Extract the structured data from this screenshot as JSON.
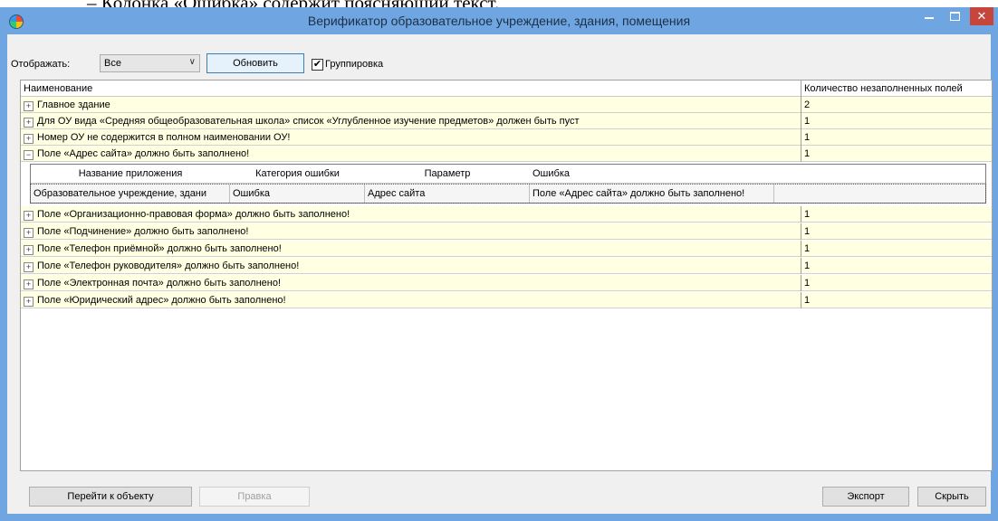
{
  "document_caption": "–    Колонка «Ошибка» содержит поясняющий текст.",
  "window": {
    "title": "Верификатор образовательное учреждение, здания, помещения",
    "close_glyph": "✕"
  },
  "toolbar": {
    "show_label": "Отображать:",
    "show_value": "Все",
    "combo_arrow": "∨",
    "refresh_label": "Обновить",
    "grouping_checked": true,
    "grouping_check_glyph": "✔",
    "grouping_label": "Группировка"
  },
  "grid": {
    "columns": [
      "Наименование",
      "Количество незаполненных полей"
    ],
    "collapsed_glyph": "+",
    "expanded_glyph": "−",
    "rows_before": [
      {
        "name": "Главное здание",
        "count": "2"
      },
      {
        "name": "Для ОУ вида «Средняя общеобразовательная школа» список «Углубленное изучение предметов» должен быть пуст",
        "count": "1"
      },
      {
        "name": "Номер ОУ не содержится в полном наименовании ОУ!",
        "count": "1"
      }
    ],
    "expanded_row": {
      "name": "Поле «Адрес сайта» должно быть заполнено!",
      "count": "1"
    },
    "detail": {
      "columns": [
        "Название приложения",
        "Категория ошибки",
        "Параметр",
        "Ошибка"
      ],
      "row": [
        "Образовательное учреждение, здани",
        "Ошибка",
        "Адрес сайта",
        "Поле «Адрес сайта» должно быть заполнено!"
      ]
    },
    "rows_after": [
      {
        "name": "Поле «Организационно-правовая форма» должно быть заполнено!",
        "count": "1"
      },
      {
        "name": "Поле «Подчинение» должно быть заполнено!",
        "count": "1"
      },
      {
        "name": "Поле «Телефон приёмной» должно быть заполнено!",
        "count": "1"
      },
      {
        "name": "Поле «Телефон руководителя» должно быть заполнено!",
        "count": "1"
      },
      {
        "name": "Поле «Электронная почта» должно быть заполнено!",
        "count": "1"
      },
      {
        "name": "Поле «Юридический адрес» должно быть заполнено!",
        "count": "1"
      }
    ]
  },
  "footer": {
    "goto_label": "Перейти к объекту",
    "edit_label": "Правка",
    "export_label": "Экспорт",
    "hide_label": "Скрыть"
  }
}
